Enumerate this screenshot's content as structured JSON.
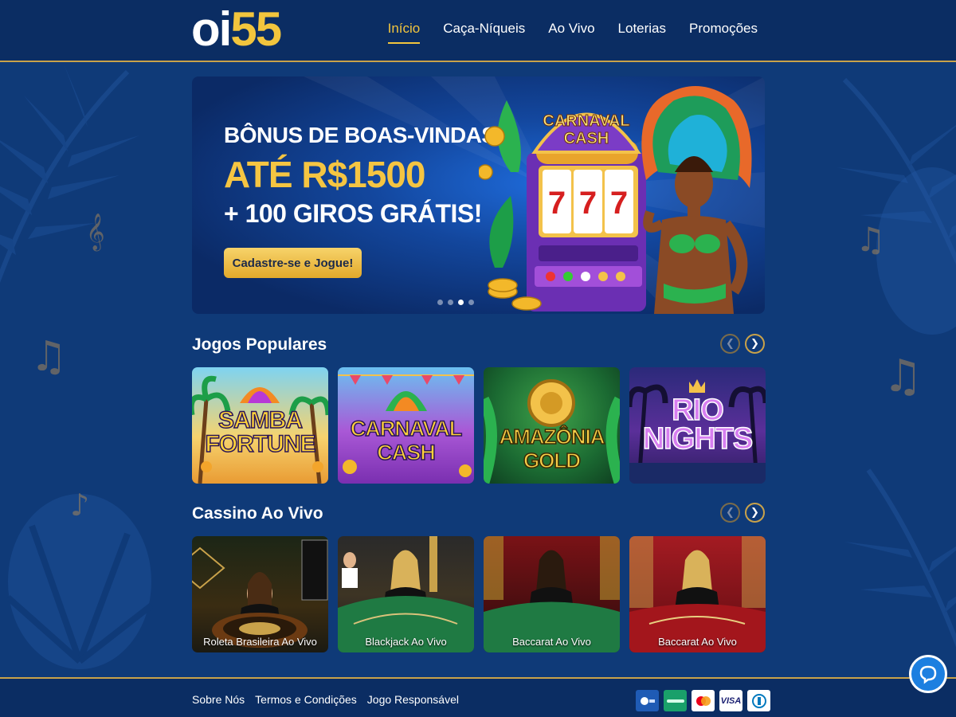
{
  "logo": {
    "part1": "oi",
    "part2": "55"
  },
  "nav": [
    {
      "label": "Início",
      "active": true
    },
    {
      "label": "Caça-Níqueis",
      "active": false
    },
    {
      "label": "Ao Vivo",
      "active": false
    },
    {
      "label": "Loterias",
      "active": false
    },
    {
      "label": "Promoções",
      "active": false
    }
  ],
  "hero": {
    "line1": "BÔNUS DE BOAS-VINDAS",
    "line2": "ATÉ R$1500",
    "line3": "+ 100 GIROS GRÁTIS!",
    "cta": "Cadastre-se e Jogue!",
    "machine_title_1": "CARNAVAL",
    "machine_title_2": "CASH",
    "reels": [
      "7",
      "7",
      "7"
    ],
    "slide_count": 4,
    "active_slide": 3
  },
  "popular": {
    "title": "Jogos Populares",
    "games": [
      {
        "line1": "SAMBA",
        "line2": "FORTUNE"
      },
      {
        "line1": "CARNAVAL",
        "line2": "CASH"
      },
      {
        "line1": "AMAZÔNIA",
        "line2": "GOLD"
      },
      {
        "line1": "RIO",
        "line2": "NIGHTS"
      }
    ]
  },
  "live": {
    "title": "Cassino Ao Vivo",
    "tables": [
      {
        "label": "Roleta Brasileira Ao Vivo"
      },
      {
        "label": "Blackjack Ao Vivo"
      },
      {
        "label": "Baccarat Ao Vivo"
      },
      {
        "label": "Baccarat Ao Vivo"
      }
    ]
  },
  "footer": {
    "links": [
      "Sobre Nós",
      "Termos e Condições",
      "Jogo Responsável"
    ],
    "payments": [
      "",
      "",
      "mastercard-icon",
      "VISA",
      ""
    ]
  },
  "colors": {
    "accent": "#f2c53d",
    "bg": "#0f3a78",
    "bar": "#0b2d63",
    "gold_border": "#c9a24a"
  }
}
